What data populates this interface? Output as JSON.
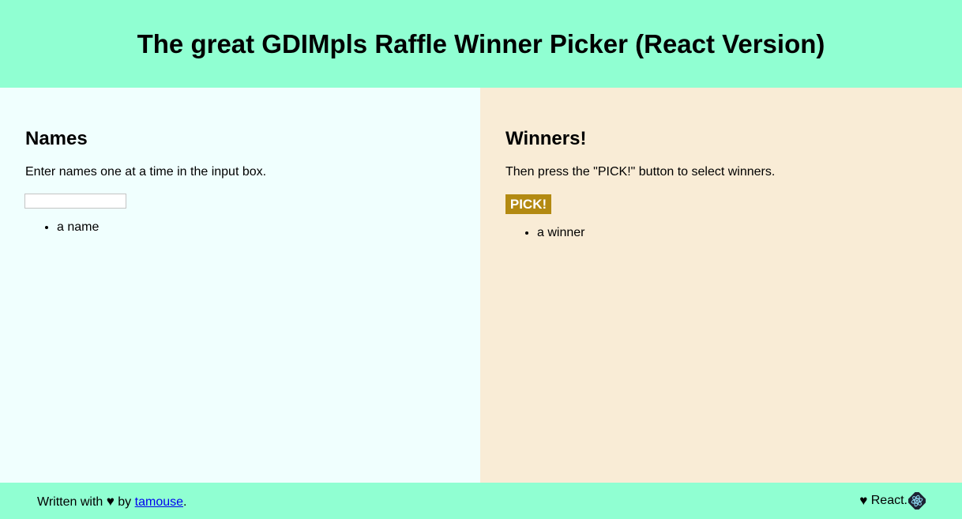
{
  "header": {
    "title": "The great GDIMpls Raffle Winner Picker (React Version)"
  },
  "names_panel": {
    "heading": "Names",
    "instructions": "Enter names one at a time in the input box.",
    "input_value": "",
    "items": [
      "a name"
    ]
  },
  "winners_panel": {
    "heading": "Winners!",
    "instructions": "Then press the \"PICK!\" button to select winners.",
    "pick_label": "PICK!",
    "items": [
      "a winner"
    ]
  },
  "footer": {
    "written_with": "Written with",
    "heart_icon": "♥",
    "by": "by",
    "author_link": "tamouse",
    "period": ".",
    "react_text": "React.",
    "react_icon": "react-logo"
  },
  "colors": {
    "header_bg": "#90ffd2",
    "left_bg": "#f0fffe",
    "right_bg": "#f9ecd6",
    "pick_bg": "#b38a12",
    "link": "#0000ee"
  }
}
